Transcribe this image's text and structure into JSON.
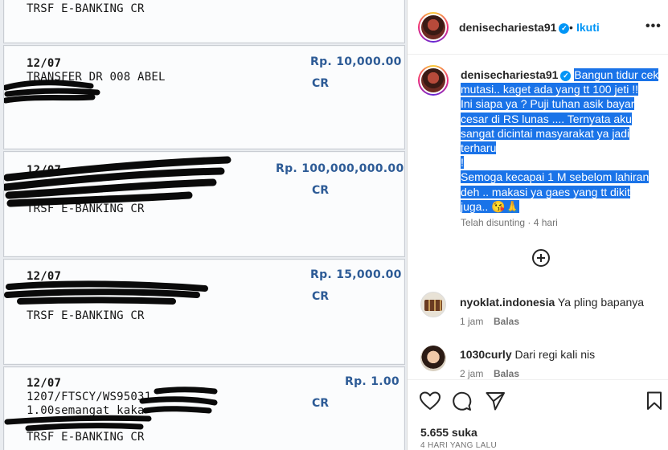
{
  "statement": {
    "top_partial": "TRSF E-BANKING CR",
    "entries": [
      {
        "date": "12/07",
        "line1": "TRANSFER   DR 008 ABEL",
        "line2": "",
        "line3": "",
        "amount": "Rp.  10,000.00",
        "type": "CR"
      },
      {
        "date": "12/07",
        "line1": "",
        "line2": "TRSF E-BANKING CR",
        "line3": "",
        "amount": "Rp.  100,000,000.00",
        "type": "CR"
      },
      {
        "date": "12/07",
        "line1": "",
        "line2": "TRSF E-BANKING CR",
        "line3": "",
        "amount": "Rp.  15,000.00",
        "type": "CR"
      },
      {
        "date": "12/07",
        "line1": "1207/FTSCY/WS95031",
        "line2": "1.00semangat kaka",
        "line3": "TRSF E-BANKING CR",
        "amount": "Rp.  1.00",
        "type": "CR"
      }
    ]
  },
  "post": {
    "author": "denisechariesta91",
    "verified": true,
    "separator": "•",
    "follow_label": "Ikuti",
    "more_label": "•••",
    "caption_lines": [
      "Bangun tidur cek",
      "mutasi.. kaget ada yang tt 100 jeti !!",
      "Ini siapa ya ? Puji tuhan asik bayar",
      "cesar di RS lunas .... Ternyata aku",
      "sangat dicintai masyarakat ya jadi",
      "terharu",
      "!",
      "Semoga kecapai 1 M sebelom lahiran",
      "deh .. makasi ya gaes yang tt dikit",
      "juga.. 😘🙏"
    ],
    "caption_meta": "Telah disunting · 4 hari",
    "comments": [
      {
        "user": "nyoklat.indonesia",
        "text": "Ya pling bapanya",
        "time": "1 jam",
        "reply": "Balas"
      },
      {
        "user": "1030curly",
        "text": "Dari regi kali nis",
        "time": "2 jam",
        "reply": "Balas"
      }
    ],
    "likes": "5.655 suka",
    "posted_ago": "4 HARI YANG LALU"
  },
  "colors": {
    "accent": "#0095f6",
    "highlight": "#1a73e8",
    "amount_blue": "#2d5b96",
    "text": "#262626",
    "muted": "#737373"
  },
  "icons": [
    "add-comment-icon",
    "heart-icon",
    "comment-icon",
    "share-icon",
    "bookmark-icon",
    "verified-icon",
    "more-icon"
  ]
}
